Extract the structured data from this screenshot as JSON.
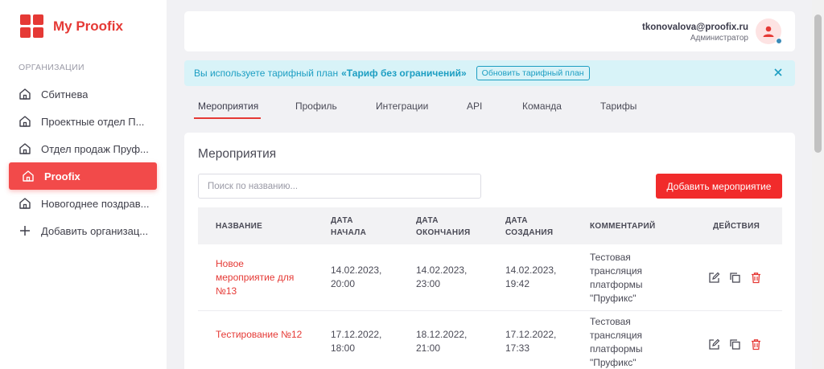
{
  "app": {
    "title": "My Proofix"
  },
  "sidebar": {
    "section_label": "ОРГАНИЗАЦИИ",
    "items": [
      {
        "label": "Сбитнева",
        "icon": "home-icon",
        "active": false
      },
      {
        "label": "Проектные отдел П...",
        "icon": "home-icon",
        "active": false
      },
      {
        "label": "Отдел продаж Пруф...",
        "icon": "home-icon",
        "active": false
      },
      {
        "label": "Proofix",
        "icon": "home-icon",
        "active": true
      },
      {
        "label": "Новогоднее поздрав...",
        "icon": "home-icon",
        "active": false
      },
      {
        "label": "Добавить организац...",
        "icon": "plus-icon",
        "active": false
      }
    ]
  },
  "header": {
    "email": "tkonovalova@proofix.ru",
    "role": "Администратор"
  },
  "banner": {
    "text": "Вы используете тарифный план",
    "plan": "«Тариф без ограничений»",
    "button": "Обновить тарифный план"
  },
  "tabs": [
    "Мероприятия",
    "Профиль",
    "Интеграции",
    "API",
    "Команда",
    "Тарифы"
  ],
  "main": {
    "title": "Мероприятия",
    "search_placeholder": "Поиск по названию...",
    "add_button": "Добавить мероприятие",
    "columns": [
      "НАЗВАНИЕ",
      "ДАТА НАЧАЛА",
      "ДАТА ОКОНЧАНИЯ",
      "ДАТА СОЗДАНИЯ",
      "КОММЕНТАРИЙ",
      "ДЕЙСТВИЯ"
    ],
    "rows": [
      {
        "name": "Новое мероприятие для №13",
        "start": "14.02.2023, 20:00",
        "end": "14.02.2023, 23:00",
        "created": "14.02.2023, 19:42",
        "comment": "Тестовая трансляция платформы \"Пруфикс\""
      },
      {
        "name": "Тестирование №12",
        "start": "17.12.2022, 18:00",
        "end": "18.12.2022, 21:00",
        "created": "17.12.2022, 17:33",
        "comment": "Тестовая трансляция платформы \"Пруфикс\""
      }
    ]
  },
  "colors": {
    "accent": "#e53935",
    "banner_bg": "#d8f3f8",
    "banner_text": "#1c9ec2"
  }
}
